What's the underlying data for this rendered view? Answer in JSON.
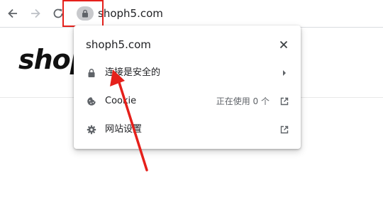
{
  "browser": {
    "url": "shoph5.com"
  },
  "page": {
    "logo_text": "shop"
  },
  "popup": {
    "title": "shoph5.com",
    "rows": [
      {
        "label": "连接是安全的",
        "icon": "lock-icon",
        "trailing": "chevron-right-icon"
      },
      {
        "label": "Cookie",
        "icon": "cookie-icon",
        "status": "正在使用 0 个",
        "trailing": "external-link-icon"
      },
      {
        "label": "网站设置",
        "icon": "gear-icon",
        "trailing": "external-link-icon"
      }
    ]
  },
  "colors": {
    "annotation_red": "#e5201b",
    "chip_gray": "#c8c9cc",
    "text": "#202124",
    "secondary_text": "#5f6368"
  }
}
